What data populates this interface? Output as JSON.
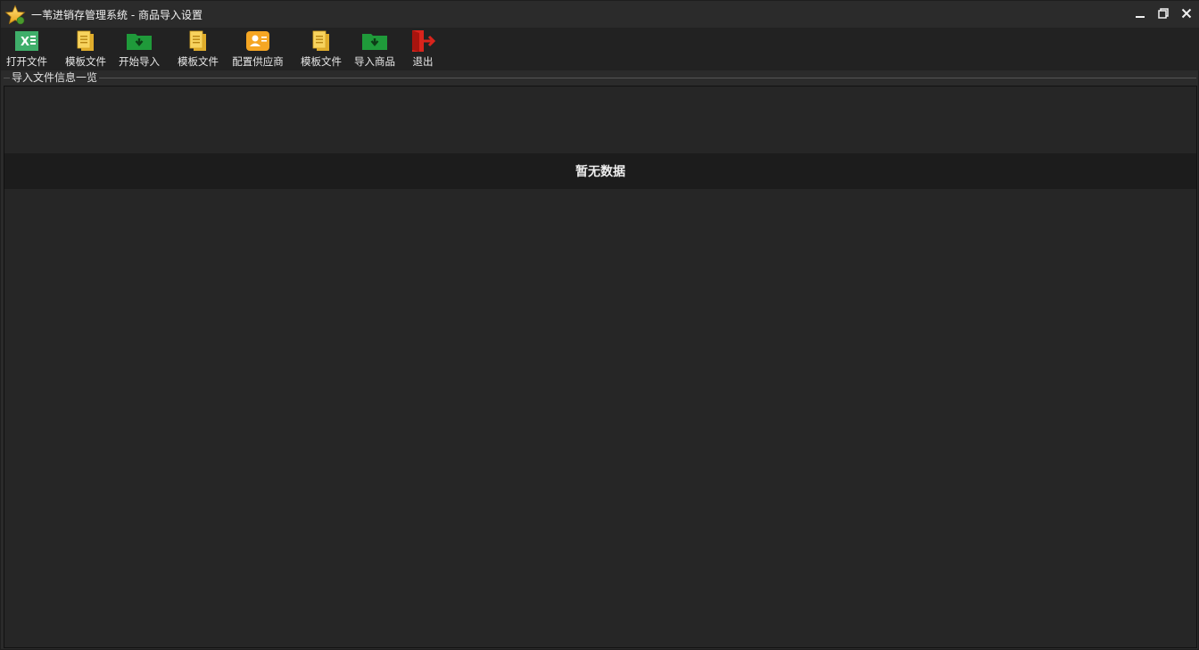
{
  "window": {
    "title": "一苇进销存管理系统 - 商品导入设置"
  },
  "toolbar": {
    "items": [
      {
        "label": "打开文件",
        "icon": "excel-icon"
      },
      {
        "label": "模板文件",
        "icon": "template-file-icon"
      },
      {
        "label": "开始导入",
        "icon": "download-folder-icon"
      },
      {
        "label": "模板文件",
        "icon": "template-file-icon"
      },
      {
        "label": "配置供应商",
        "icon": "supplier-card-icon"
      },
      {
        "label": "模板文件",
        "icon": "template-file-icon"
      },
      {
        "label": "导入商品",
        "icon": "download-folder-icon"
      },
      {
        "label": "退出",
        "icon": "exit-icon"
      }
    ]
  },
  "group": {
    "title": "导入文件信息一览"
  },
  "grid": {
    "empty_text": "暂无数据"
  },
  "colors": {
    "background": "#2b2b2b",
    "toolbar": "#222222",
    "grid": "#262626",
    "empty_band": "#1c1c1c",
    "excel_green": "#3fae6a",
    "folder_green": "#1f9a3a",
    "file_yellow": "#f2c94c",
    "supplier_orange": "#f5a623",
    "exit_red": "#d9241c"
  }
}
